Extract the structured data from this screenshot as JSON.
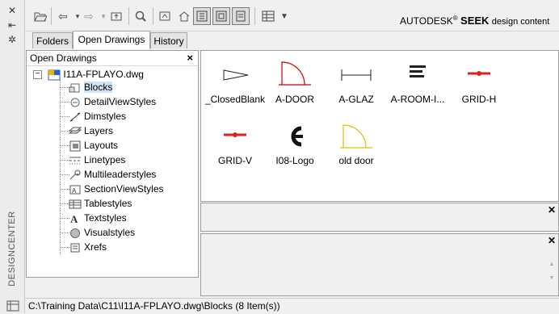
{
  "palette_title": "DESIGNCENTER",
  "toolbar": {
    "brand_autodesk": "AUTODESK",
    "brand_reg": "®",
    "brand_seek": "SEEK",
    "brand_tail": "design content"
  },
  "tabs": [
    {
      "label": "Folders"
    },
    {
      "label": "Open Drawings"
    },
    {
      "label": "History"
    }
  ],
  "tree": {
    "header": "Open Drawings",
    "close": "×",
    "root": "I11A-FPLAYO.dwg",
    "children": [
      {
        "label": "Blocks",
        "selected": true
      },
      {
        "label": "DetailViewStyles"
      },
      {
        "label": "Dimstyles"
      },
      {
        "label": "Layers"
      },
      {
        "label": "Layouts"
      },
      {
        "label": "Linetypes"
      },
      {
        "label": "Multileaderstyles"
      },
      {
        "label": "SectionViewStyles"
      },
      {
        "label": "Tablestyles"
      },
      {
        "label": "Textstyles"
      },
      {
        "label": "Visualstyles"
      },
      {
        "label": "Xrefs"
      }
    ]
  },
  "blocks": [
    {
      "name": "_ClosedBlank"
    },
    {
      "name": "A-DOOR"
    },
    {
      "name": "A-GLAZ"
    },
    {
      "name": "A-ROOM-I..."
    },
    {
      "name": "GRID-H"
    },
    {
      "name": "GRID-V"
    },
    {
      "name": "I08-Logo"
    },
    {
      "name": "old door"
    }
  ],
  "status": {
    "path": "C:\\Training Data\\C11\\I11A-FPLAYO.dwg\\Blocks (8 Item(s))"
  }
}
